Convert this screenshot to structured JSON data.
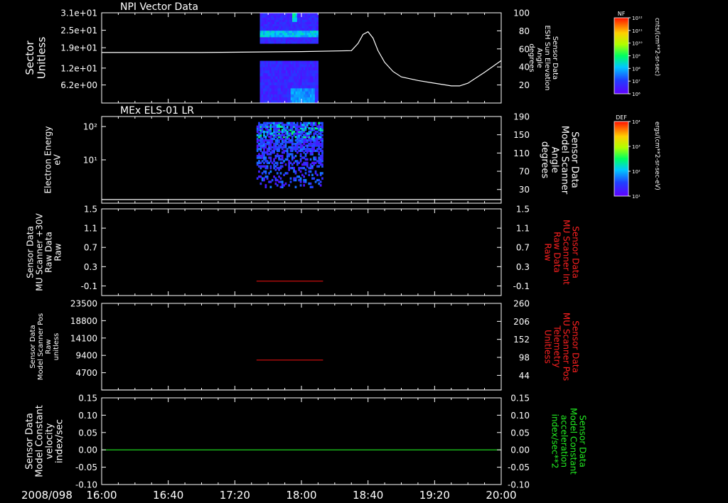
{
  "chart_data": {
    "type": "line",
    "date_label": "2008/098",
    "time_axis": {
      "range": [
        "16:00",
        "20:00"
      ],
      "ticks": [
        "16:00",
        "16:40",
        "17:20",
        "18:00",
        "18:40",
        "19:20",
        "20:00"
      ]
    },
    "panels": [
      {
        "id": "npi",
        "title": "NPI Vector Data",
        "kind": "spectrogram+line",
        "left_axis": {
          "label": [
            "Sector",
            "Unitless"
          ],
          "ticks": [
            "3.1e+01",
            "2.5e+01",
            "1.9e+01",
            "1.2e+01",
            "6.2e+00"
          ],
          "tick_values": [
            31,
            25,
            19,
            12,
            6.2
          ],
          "range": [
            0,
            31
          ]
        },
        "right_axis": {
          "label": [
            "Sensor Data",
            "ESH Sun Elevation",
            "Angle",
            "degrees"
          ],
          "ticks": [
            "100",
            "80",
            "60",
            "40",
            "20"
          ],
          "tick_values": [
            100,
            80,
            60,
            40,
            20
          ],
          "range": [
            0,
            100
          ],
          "color": "#ffffff"
        },
        "spectrogram_time_range": [
          "17:35",
          "18:10"
        ],
        "colorbar": {
          "label": "NF",
          "units": "cnts/(cm**2-sr-sec)",
          "ticks": [
            "10¹²",
            "10¹¹",
            "10¹⁰",
            "10⁹",
            "10⁸",
            "10⁷",
            "10⁶"
          ]
        },
        "line_series": {
          "name": "ESH Sun Elevation Angle",
          "color": "#ffffff",
          "points": [
            {
              "t": "16:00",
              "v": 56
            },
            {
              "t": "17:00",
              "v": 56
            },
            {
              "t": "18:00",
              "v": 57
            },
            {
              "t": "18:30",
              "v": 58
            },
            {
              "t": "18:34",
              "v": 66
            },
            {
              "t": "18:37",
              "v": 76
            },
            {
              "t": "18:40",
              "v": 79
            },
            {
              "t": "18:43",
              "v": 72
            },
            {
              "t": "18:46",
              "v": 58
            },
            {
              "t": "18:50",
              "v": 45
            },
            {
              "t": "18:55",
              "v": 35
            },
            {
              "t": "19:00",
              "v": 29
            },
            {
              "t": "19:10",
              "v": 25
            },
            {
              "t": "19:20",
              "v": 22
            },
            {
              "t": "19:30",
              "v": 19
            },
            {
              "t": "19:35",
              "v": 19
            },
            {
              "t": "19:40",
              "v": 22
            },
            {
              "t": "19:50",
              "v": 34
            },
            {
              "t": "20:00",
              "v": 47
            }
          ]
        }
      },
      {
        "id": "els",
        "title": "MEx ELS-01 LR",
        "kind": "spectrogram+line",
        "left_axis": {
          "label": [
            "Electron Energy",
            "eV"
          ],
          "ticks": [
            "10²",
            "10¹"
          ],
          "tick_values": [
            100,
            10
          ],
          "scale": "log",
          "range": [
            0.5,
            200
          ]
        },
        "right_axis": {
          "label": [
            "Sensor Data",
            "Model Scanner",
            "Angle",
            "degrees"
          ],
          "ticks": [
            "190",
            "150",
            "110",
            "70",
            "30"
          ],
          "tick_values": [
            190,
            150,
            110,
            70,
            30
          ],
          "range": [
            0,
            190
          ],
          "color": "#ffffff"
        },
        "spectrogram_time_range": [
          "17:33",
          "18:13"
        ],
        "colorbar": {
          "label": "DEF",
          "units": "ergs/(cm**2-sr-sec-eV)",
          "ticks": [
            "10⁴",
            "10³",
            "10²",
            "10¹"
          ]
        },
        "line_series": {
          "name": "Model Scanner Angle",
          "color": "#ffffff",
          "points": [
            {
              "t": "16:00",
              "v": 8
            },
            {
              "t": "20:00",
              "v": 8
            }
          ]
        }
      },
      {
        "id": "mu_raw",
        "title": "",
        "kind": "line",
        "left_axis": {
          "label": [
            "Sensor Data",
            "MU Scanner +30V",
            "Raw Data",
            "Raw"
          ],
          "ticks": [
            "1.5",
            "1.1",
            "0.7",
            "0.3",
            "-0.1"
          ],
          "tick_values": [
            1.5,
            1.1,
            0.7,
            0.3,
            -0.1
          ],
          "range": [
            -0.3,
            1.5
          ]
        },
        "right_axis": {
          "label": [
            "Sensor Data",
            "MU Scanner Int",
            "Raw Data",
            "Raw"
          ],
          "ticks": [
            "1.5",
            "1.1",
            "0.7",
            "0.3",
            "-0.1"
          ],
          "tick_values": [
            1.5,
            1.1,
            0.7,
            0.3,
            -0.1
          ],
          "range": [
            -0.3,
            1.5
          ],
          "color": "#ff2020"
        },
        "line_series": {
          "name": "MU Scanner Int Raw Data",
          "color": "#dd1111",
          "points": [
            {
              "t": "17:33",
              "v": 0.0
            },
            {
              "t": "18:13",
              "v": 0.0
            }
          ]
        }
      },
      {
        "id": "mu_pos",
        "title": "",
        "kind": "line",
        "left_axis": {
          "label": [
            "Sensor Data",
            "Model Scanner Pos",
            "Raw",
            "unitless"
          ],
          "ticks": [
            "23500",
            "18800",
            "14100",
            "9400",
            "4700"
          ],
          "tick_values": [
            23500,
            18800,
            14100,
            9400,
            4700
          ],
          "range": [
            0,
            23500
          ]
        },
        "right_axis": {
          "label": [
            "Sensor Data",
            "MU Scanner Pos",
            "Telemetry",
            "Unitless"
          ],
          "ticks": [
            "260",
            "206",
            "152",
            "98",
            "44"
          ],
          "tick_values": [
            260,
            206,
            152,
            98,
            44
          ],
          "range": [
            0,
            260
          ],
          "color": "#ff2020"
        },
        "line_series": {
          "name": "MU Scanner Pos Telemetry",
          "color": "#dd1111",
          "points": [
            {
              "t": "17:33",
              "v": 90
            },
            {
              "t": "18:13",
              "v": 90
            }
          ]
        },
        "baseline_series": {
          "name": "Model Scanner Pos",
          "color": "#ffffff",
          "points": [
            {
              "t": "16:00",
              "v": 0
            },
            {
              "t": "20:00",
              "v": 0
            }
          ]
        }
      },
      {
        "id": "model_const",
        "title": "",
        "kind": "line",
        "left_axis": {
          "label": [
            "Sensor Data",
            "Model Constant",
            "velocity",
            "index/sec"
          ],
          "ticks": [
            "0.15",
            "0.10",
            "0.05",
            "0.00",
            "-0.05",
            "-0.10"
          ],
          "tick_values": [
            0.15,
            0.1,
            0.05,
            0.0,
            -0.05,
            -0.1
          ],
          "range": [
            -0.1,
            0.15
          ]
        },
        "right_axis": {
          "label": [
            "Sensor Data",
            "Model Constant",
            "acceleration",
            "index/sec**2"
          ],
          "ticks": [
            "0.15",
            "0.10",
            "0.05",
            "0.00",
            "-0.05",
            "-0.10"
          ],
          "tick_values": [
            0.15,
            0.1,
            0.05,
            0.0,
            -0.05,
            -0.1
          ],
          "range": [
            -0.1,
            0.15
          ],
          "color": "#22ee22"
        },
        "line_series": {
          "name": "Model Constant acceleration",
          "color": "#22ee22",
          "points": [
            {
              "t": "16:00",
              "v": 0.0
            },
            {
              "t": "20:00",
              "v": 0.0
            }
          ]
        }
      }
    ]
  }
}
